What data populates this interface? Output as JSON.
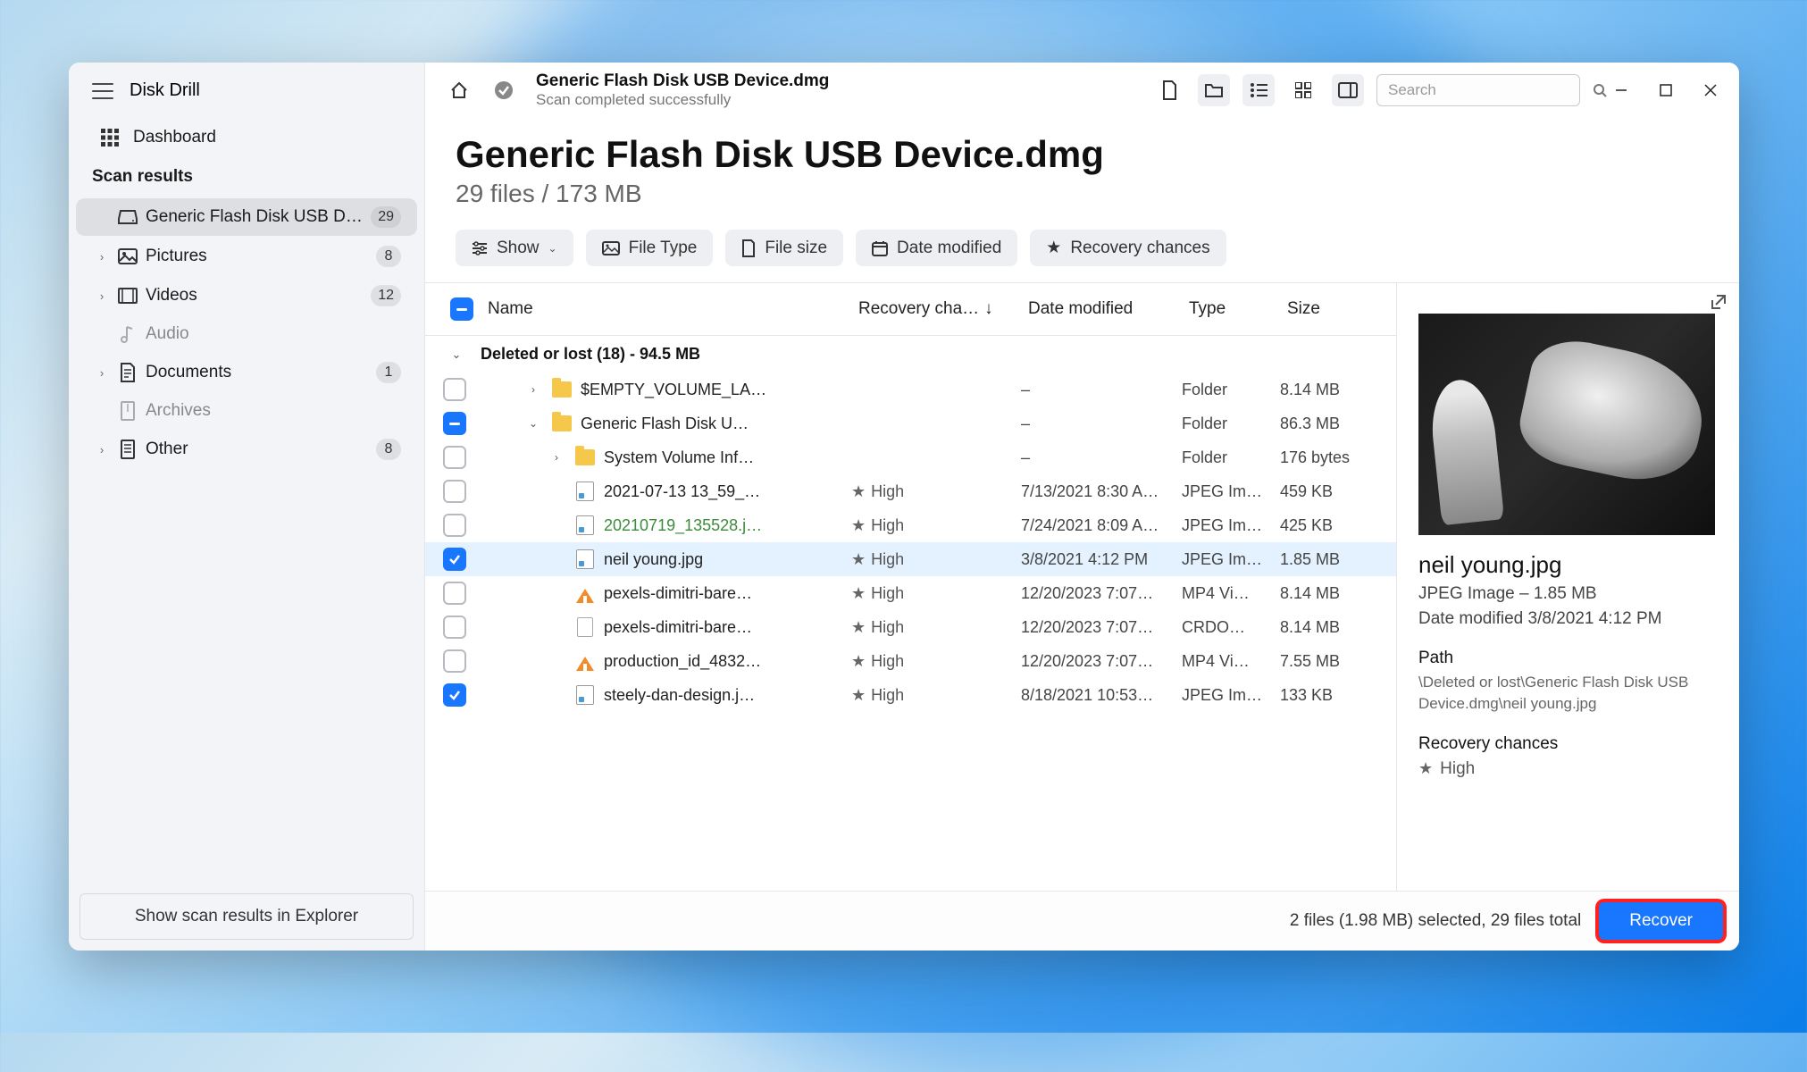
{
  "app_title": "Disk Drill",
  "sidebar": {
    "dashboard_label": "Dashboard",
    "section_label": "Scan results",
    "items": [
      {
        "label": "Generic Flash Disk USB D…",
        "badge": "29",
        "chev": "",
        "active": true
      },
      {
        "label": "Pictures",
        "badge": "8",
        "chev": "›"
      },
      {
        "label": "Videos",
        "badge": "12",
        "chev": "›"
      },
      {
        "label": "Audio",
        "badge": "",
        "chev": "",
        "muted": true
      },
      {
        "label": "Documents",
        "badge": "1",
        "chev": "›"
      },
      {
        "label": "Archives",
        "badge": "",
        "chev": "",
        "muted": true
      },
      {
        "label": "Other",
        "badge": "8",
        "chev": "›"
      }
    ],
    "bottom_button": "Show scan results in Explorer"
  },
  "toolbar": {
    "title": "Generic Flash Disk USB Device.dmg",
    "subtitle": "Scan completed successfully",
    "search_placeholder": "Search"
  },
  "page": {
    "title": "Generic Flash Disk USB Device.dmg",
    "subtitle": "29 files / 173 MB",
    "filters": {
      "show": "Show",
      "file_type": "File Type",
      "file_size": "File size",
      "date_modified": "Date modified",
      "recovery": "Recovery chances"
    }
  },
  "table": {
    "columns": {
      "name": "Name",
      "recovery": "Recovery cha…",
      "date": "Date modified",
      "type": "Type",
      "size": "Size"
    },
    "group_label": "Deleted or lost (18) - 94.5 MB",
    "rows": [
      {
        "indent": 0,
        "chev": "›",
        "icon": "folder",
        "name": "$EMPTY_VOLUME_LA…",
        "rec": "",
        "date": "–",
        "type": "Folder",
        "size": "8.14 MB",
        "checked": false
      },
      {
        "indent": 0,
        "chev": "⌄",
        "icon": "folder",
        "name": "Generic Flash Disk U…",
        "rec": "",
        "date": "–",
        "type": "Folder",
        "size": "86.3 MB",
        "checked": "indet"
      },
      {
        "indent": 1,
        "chev": "›",
        "icon": "folder",
        "name": "System Volume Inf…",
        "rec": "",
        "date": "–",
        "type": "Folder",
        "size": "176 bytes",
        "checked": false
      },
      {
        "indent": 1,
        "chev": "",
        "icon": "img",
        "name": "2021-07-13 13_59_…",
        "rec": "High",
        "date": "7/13/2021 8:30 A…",
        "type": "JPEG Im…",
        "size": "459 KB",
        "checked": false
      },
      {
        "indent": 1,
        "chev": "",
        "icon": "img",
        "name": "20210719_135528.j…",
        "rec": "High",
        "date": "7/24/2021 8:09 A…",
        "type": "JPEG Im…",
        "size": "425 KB",
        "checked": false,
        "green": true
      },
      {
        "indent": 1,
        "chev": "",
        "icon": "img",
        "name": "neil young.jpg",
        "rec": "High",
        "date": "3/8/2021 4:12 PM",
        "type": "JPEG Im…",
        "size": "1.85 MB",
        "checked": true,
        "selected": true
      },
      {
        "indent": 1,
        "chev": "",
        "icon": "video",
        "name": "pexels-dimitri-bare…",
        "rec": "High",
        "date": "12/20/2023 7:07…",
        "type": "MP4 Vi…",
        "size": "8.14 MB",
        "checked": false
      },
      {
        "indent": 1,
        "chev": "",
        "icon": "doc",
        "name": "pexels-dimitri-bare…",
        "rec": "High",
        "date": "12/20/2023 7:07…",
        "type": "CRDO…",
        "size": "8.14 MB",
        "checked": false
      },
      {
        "indent": 1,
        "chev": "",
        "icon": "video",
        "name": "production_id_4832…",
        "rec": "High",
        "date": "12/20/2023 7:07…",
        "type": "MP4 Vi…",
        "size": "7.55 MB",
        "checked": false
      },
      {
        "indent": 1,
        "chev": "",
        "icon": "img",
        "name": "steely-dan-design.j…",
        "rec": "High",
        "date": "8/18/2021 10:53…",
        "type": "JPEG Im…",
        "size": "133 KB",
        "checked": true
      }
    ]
  },
  "preview": {
    "name": "neil young.jpg",
    "meta1": "JPEG Image – 1.85 MB",
    "meta2": "Date modified 3/8/2021 4:12 PM",
    "path_label": "Path",
    "path": "\\Deleted or lost\\Generic Flash Disk USB Device.dmg\\neil young.jpg",
    "recovery_label": "Recovery chances",
    "recovery_value": "High"
  },
  "footer": {
    "status": "2 files (1.98 MB) selected, 29 files total",
    "recover_label": "Recover"
  }
}
